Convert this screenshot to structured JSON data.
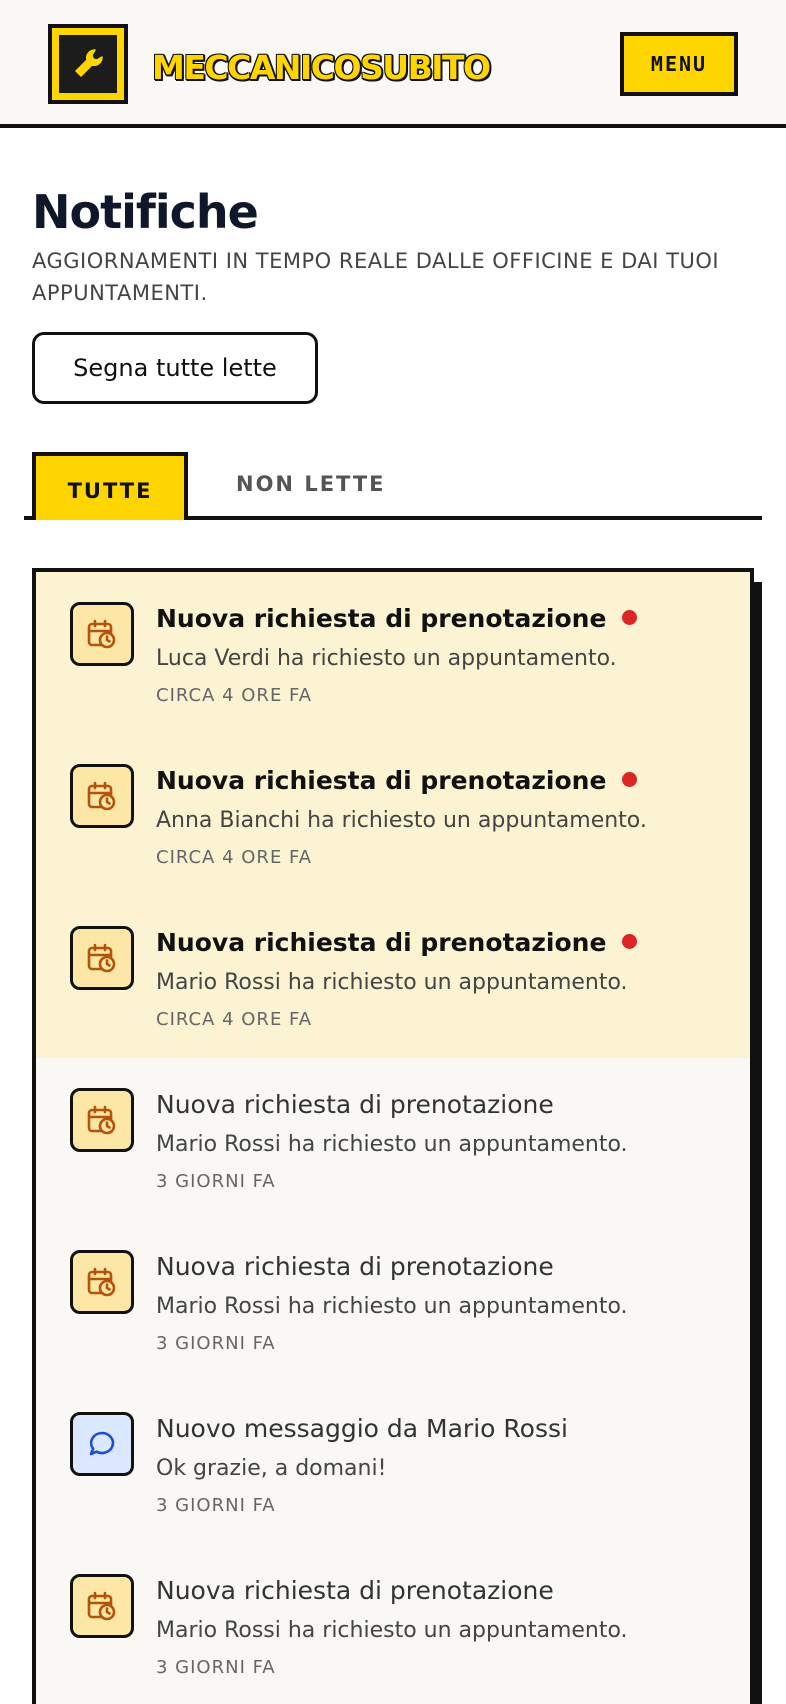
{
  "header": {
    "brand": "MECCANICOSUBITO",
    "menu_label": "MENU",
    "logo_icon": "wrench-icon"
  },
  "page": {
    "title": "Notifiche",
    "subtitle": "AGGIORNAMENTI IN TEMPO REALE DALLE OFFICINE E DAI TUOI APPUNTAMENTI.",
    "mark_all_label": "Segna tutte lette"
  },
  "tabs": [
    {
      "label": "TUTTE",
      "active": true
    },
    {
      "label": "NON LETTE",
      "active": false
    }
  ],
  "colors": {
    "accent": "#FFD500",
    "unread_bg": "#FBF3D2",
    "unread_dot": "#DC2626",
    "calendar_icon_bg": "#FDE7A6",
    "message_icon_bg": "#DBE8FF"
  },
  "notifications": [
    {
      "icon": "calendar-clock-icon",
      "title": "Nuova richiesta di prenotazione",
      "body": "Luca Verdi ha richiesto un appuntamento.",
      "time": "CIRCA 4 ORE FA",
      "unread": true
    },
    {
      "icon": "calendar-clock-icon",
      "title": "Nuova richiesta di prenotazione",
      "body": "Anna Bianchi ha richiesto un appuntamento.",
      "time": "CIRCA 4 ORE FA",
      "unread": true
    },
    {
      "icon": "calendar-clock-icon",
      "title": "Nuova richiesta di prenotazione",
      "body": "Mario Rossi ha richiesto un appuntamento.",
      "time": "CIRCA 4 ORE FA",
      "unread": true
    },
    {
      "icon": "calendar-clock-icon",
      "title": "Nuova richiesta di prenotazione",
      "body": "Mario Rossi ha richiesto un appuntamento.",
      "time": "3 GIORNI FA",
      "unread": false
    },
    {
      "icon": "calendar-clock-icon",
      "title": "Nuova richiesta di prenotazione",
      "body": "Mario Rossi ha richiesto un appuntamento.",
      "time": "3 GIORNI FA",
      "unread": false
    },
    {
      "icon": "message-bubble-icon",
      "title": "Nuovo messaggio da Mario Rossi",
      "body": "Ok grazie, a domani!",
      "time": "3 GIORNI FA",
      "unread": false
    },
    {
      "icon": "calendar-clock-icon",
      "title": "Nuova richiesta di prenotazione",
      "body": "Mario Rossi ha richiesto un appuntamento.",
      "time": "3 GIORNI FA",
      "unread": false
    }
  ]
}
